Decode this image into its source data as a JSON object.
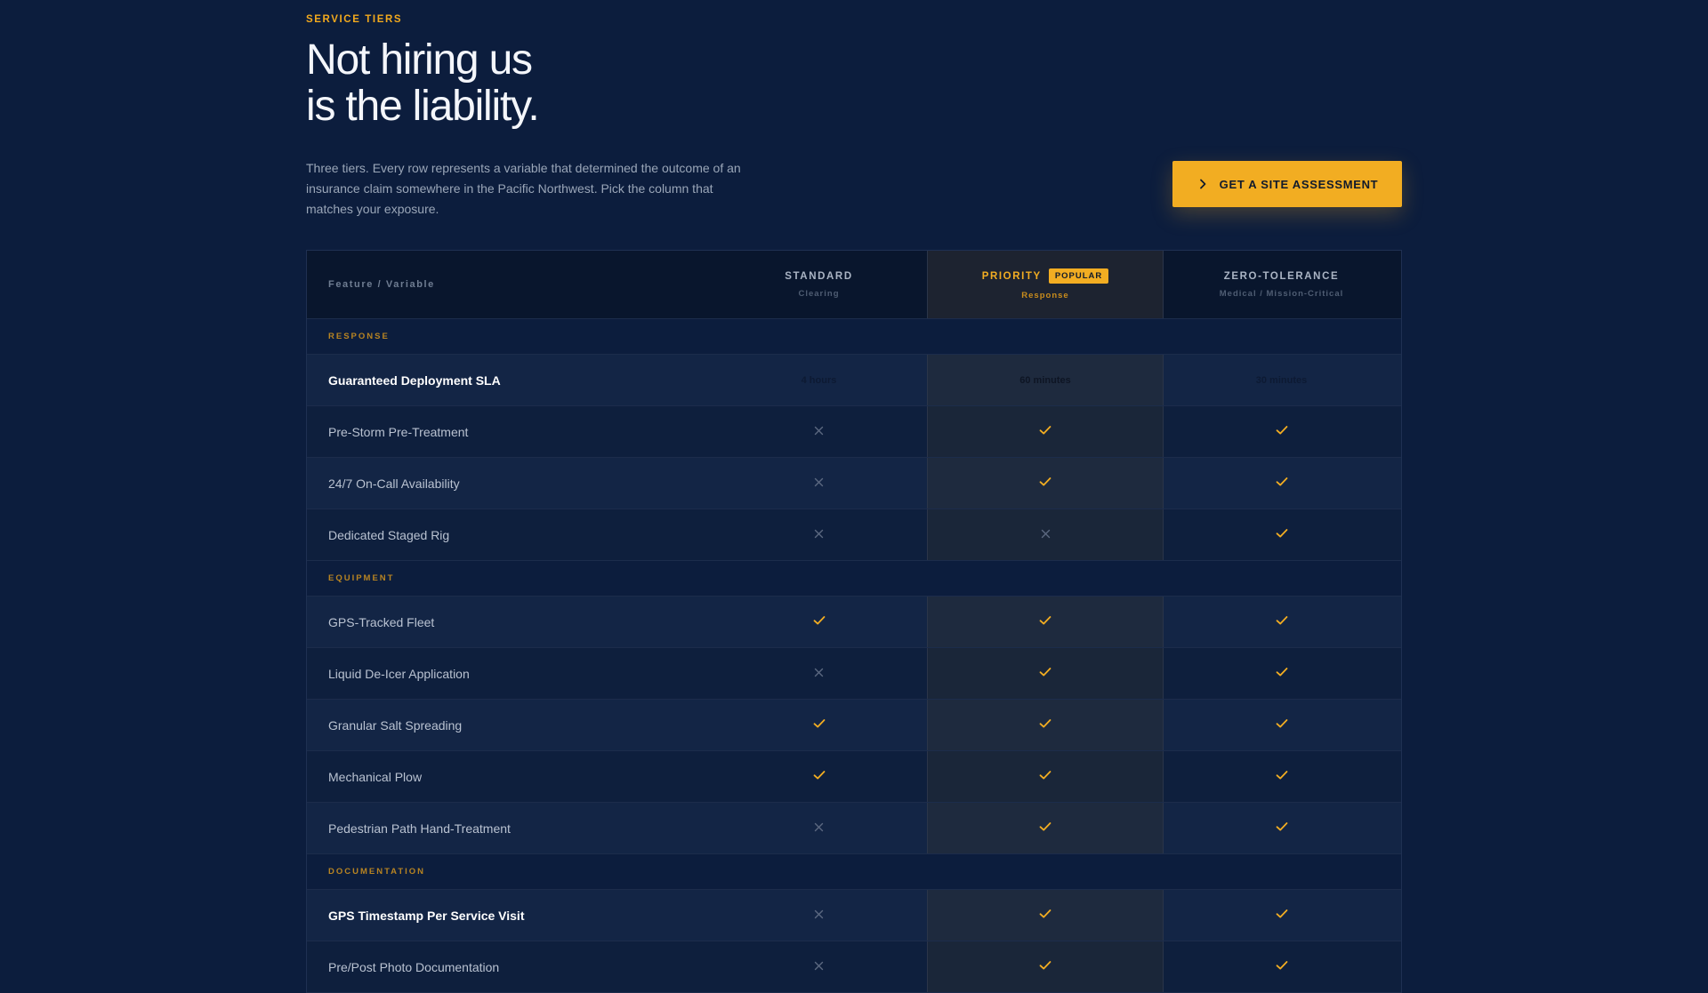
{
  "hero": {
    "eyebrow": "SERVICE TIERS",
    "headline_line1": "Not hiring us",
    "headline_line2": "is the liability.",
    "description": "Three tiers. Every row represents a variable that determined the outcome of an insurance claim somewhere in the Pacific Northwest. Pick the column that matches your exposure.",
    "cta_label": "GET A SITE ASSESSMENT",
    "cta_icon": "chevron-right-icon"
  },
  "colors": {
    "accent": "#f2ad22",
    "background": "#0c1d3d",
    "check": "#f2ad22",
    "cross": "#5b6880"
  },
  "table": {
    "feature_header": "Feature / Variable",
    "tiers": [
      {
        "name": "STANDARD",
        "sub": "Clearing"
      },
      {
        "name": "PRIORITY",
        "sub": "Response",
        "badge": "POPULAR"
      },
      {
        "name": "ZERO-TOLERANCE",
        "sub": "Medical / Mission-Critical"
      }
    ],
    "sections": [
      {
        "label": "RESPONSE",
        "rows": [
          {
            "feature": "Guaranteed Deployment SLA",
            "bold": true,
            "values": [
              "4 hours",
              "60 minutes",
              "30 minutes"
            ]
          },
          {
            "feature": "Pre-Storm Pre-Treatment",
            "values": [
              "cross",
              "check",
              "check"
            ]
          },
          {
            "feature": "24/7 On-Call Availability",
            "values": [
              "cross",
              "check",
              "check"
            ]
          },
          {
            "feature": "Dedicated Staged Rig",
            "values": [
              "cross",
              "cross",
              "check"
            ]
          }
        ]
      },
      {
        "label": "EQUIPMENT",
        "rows": [
          {
            "feature": "GPS-Tracked Fleet",
            "values": [
              "check",
              "check",
              "check"
            ]
          },
          {
            "feature": "Liquid De-Icer Application",
            "values": [
              "cross",
              "check",
              "check"
            ]
          },
          {
            "feature": "Granular Salt Spreading",
            "values": [
              "check",
              "check",
              "check"
            ]
          },
          {
            "feature": "Mechanical Plow",
            "values": [
              "check",
              "check",
              "check"
            ]
          },
          {
            "feature": "Pedestrian Path Hand-Treatment",
            "values": [
              "cross",
              "check",
              "check"
            ]
          }
        ]
      },
      {
        "label": "DOCUMENTATION",
        "rows": [
          {
            "feature": "GPS Timestamp Per Service Visit",
            "bold": true,
            "values": [
              "cross",
              "check",
              "check"
            ]
          },
          {
            "feature": "Pre/Post Photo Documentation",
            "values": [
              "cross",
              "check",
              "check"
            ]
          }
        ]
      }
    ]
  }
}
